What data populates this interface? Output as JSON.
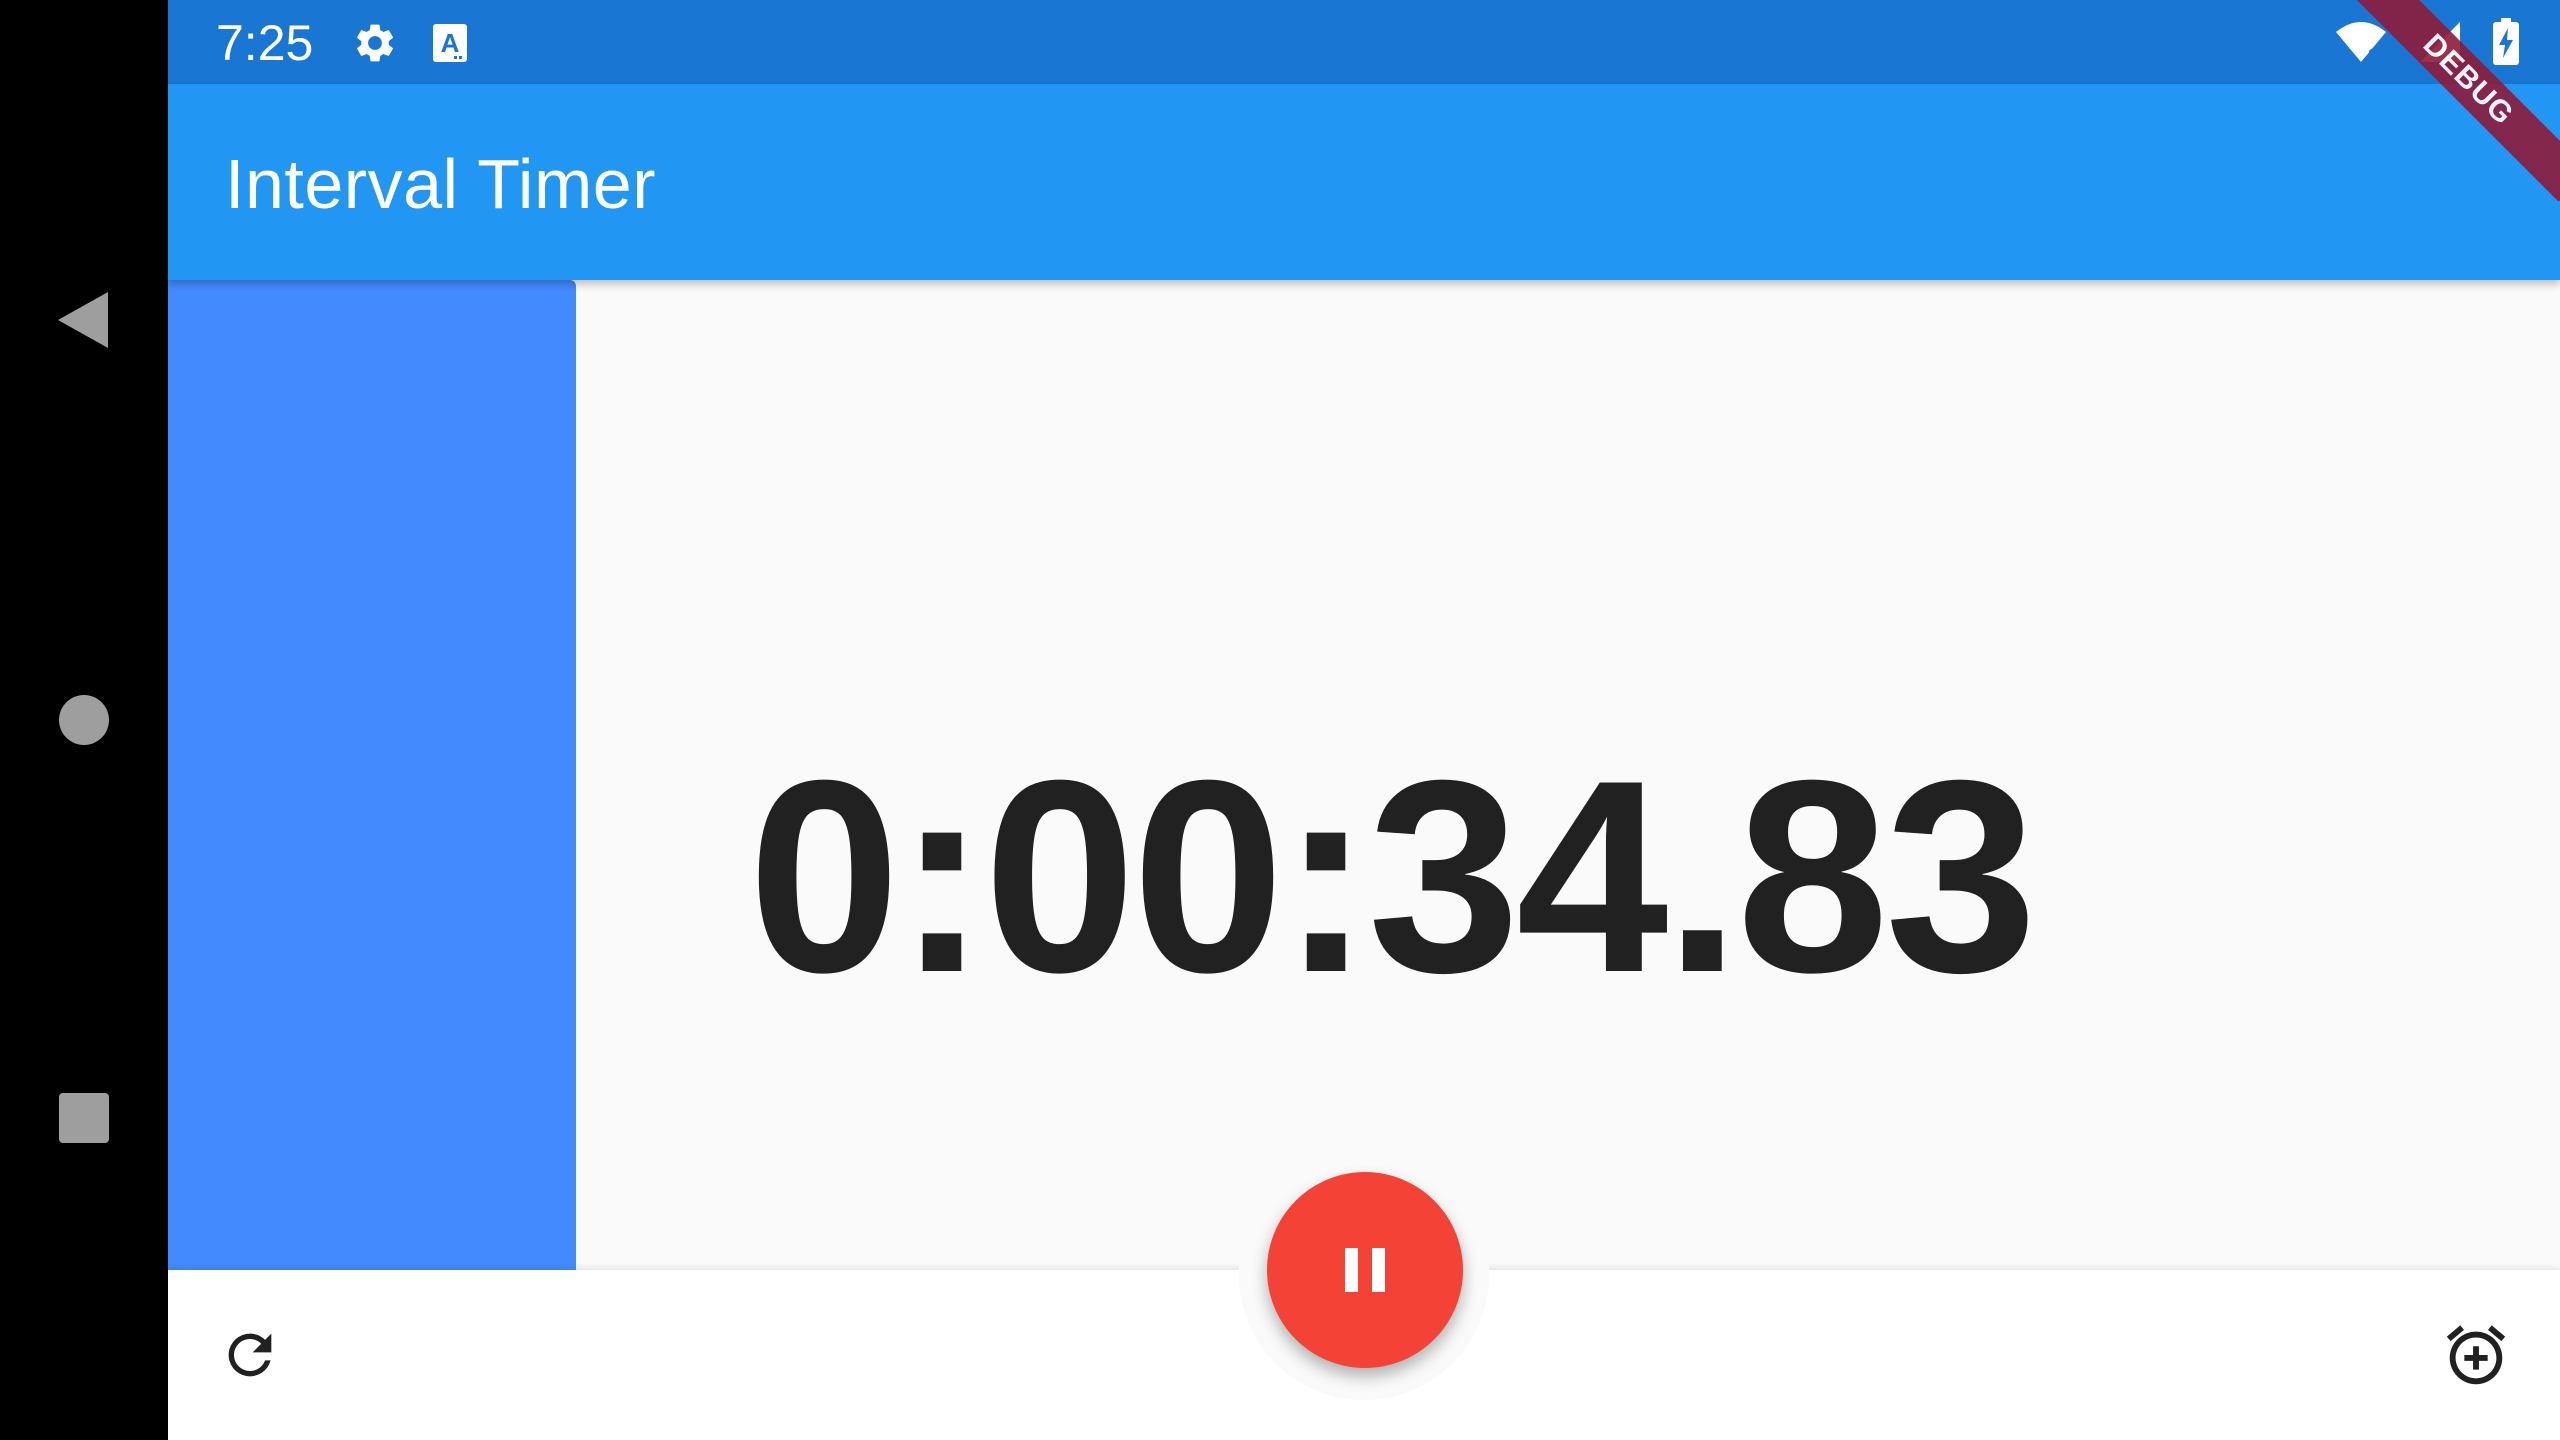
{
  "status_bar": {
    "time": "7:25",
    "icons_left": [
      "settings-icon",
      "keyboard-a-icon"
    ],
    "icons_right": [
      "wifi-icon",
      "signal-icon",
      "battery-charging-icon"
    ],
    "color": "#1976d2"
  },
  "app_bar": {
    "title": "Interval Timer",
    "color": "#2196f3"
  },
  "timer": {
    "display": "0:00:34.83"
  },
  "progress_panel": {
    "color": "#448aff"
  },
  "fab": {
    "icon": "pause-icon",
    "color": "#f44336"
  },
  "bottom_bar": {
    "left_icon": "reset-icon",
    "right_icon": "add-alarm-icon"
  },
  "nav_bar": {
    "items": [
      "back-icon",
      "home-icon",
      "recents-icon"
    ]
  },
  "debug_banner": {
    "label": "DEBUG"
  }
}
